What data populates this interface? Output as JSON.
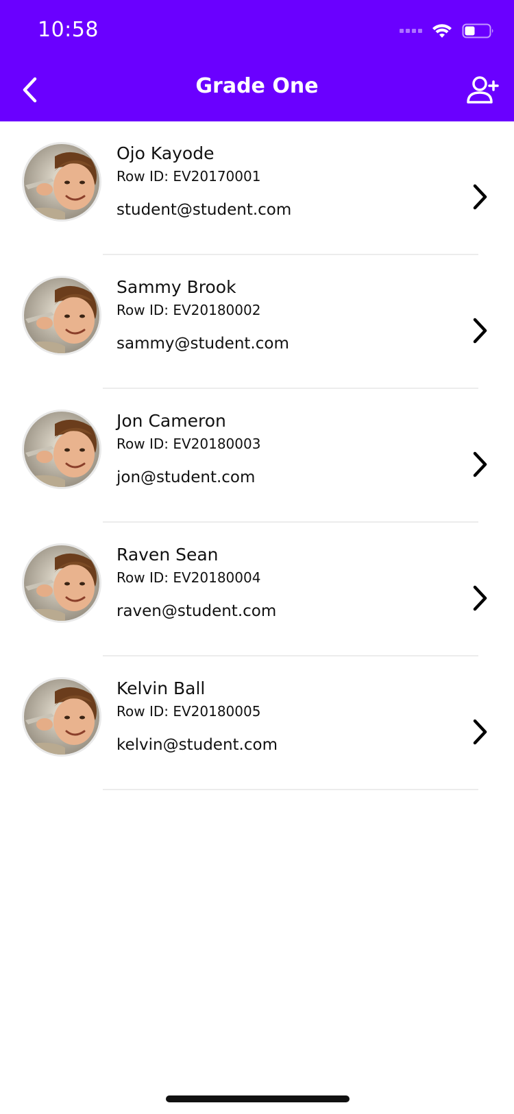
{
  "status_bar": {
    "time": "10:58",
    "icons": [
      "cellular-signal-icon",
      "wifi-icon",
      "battery-icon"
    ]
  },
  "nav": {
    "title": "Grade One",
    "back_icon": "chevron-left-icon",
    "add_icon": "add-user-icon"
  },
  "colors": {
    "header_bg": "#6a00ff",
    "text": "#111111",
    "divider": "#ececec"
  },
  "students": [
    {
      "name": "Ojo Kayode",
      "row_id": "Row ID: EV20170001",
      "email": "student@student.com"
    },
    {
      "name": "Sammy Brook",
      "row_id": "Row ID: EV20180002",
      "email": "sammy@student.com"
    },
    {
      "name": "Jon Cameron",
      "row_id": "Row ID: EV20180003",
      "email": "jon@student.com"
    },
    {
      "name": "Raven Sean",
      "row_id": "Row ID: EV20180004",
      "email": "raven@student.com"
    },
    {
      "name": "Kelvin Ball",
      "row_id": "Row ID: EV20180005",
      "email": "kelvin@student.com"
    }
  ]
}
